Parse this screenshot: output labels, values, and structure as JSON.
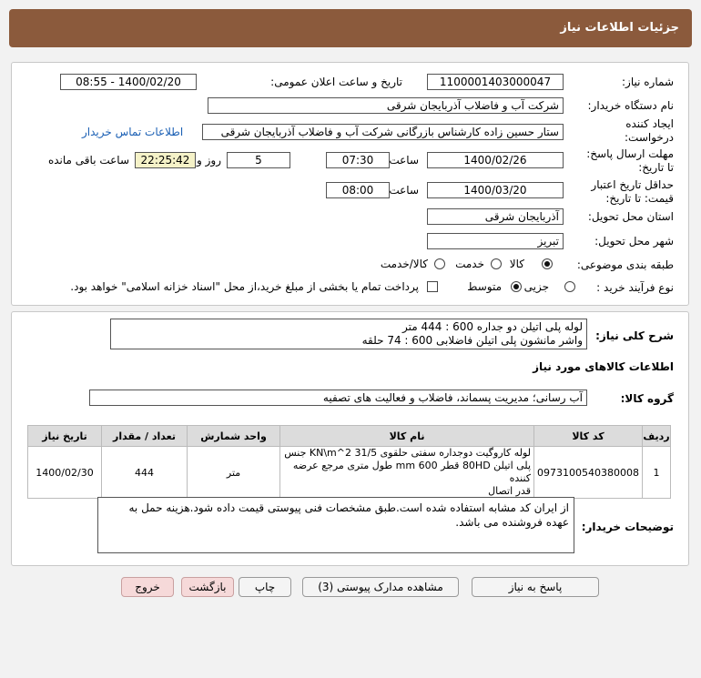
{
  "header": {
    "title": "جزئیات اطلاعات نیاز"
  },
  "form": {
    "need_number_label": "شماره نیاز:",
    "need_number": "1100001403000047",
    "announce_label": "تاریخ و ساعت اعلان عمومی:",
    "announce_value": "1400/02/20 - 08:55",
    "buyer_label": "نام دستگاه خریدار:",
    "buyer_value": "شرکت آب و فاضلاب آذربایجان شرقی",
    "creator_label": "ایجاد کننده درخواست:",
    "creator_value": "ستار حسین زاده کارشناس بازرگانی شرکت آب و فاضلاب آذربایجان شرقی",
    "contact_link": "اطلاعات تماس خریدار",
    "deadline_label": "مهلت ارسال پاسخ: تا تاریخ:",
    "deadline_date": "1400/02/26",
    "time_label": "ساعت",
    "deadline_time": "07:30",
    "days_value": "5",
    "days_label": "روز و",
    "remaining_value": "22:25:42",
    "remaining_label": "ساعت باقی مانده",
    "validity_label": "حداقل تاریخ اعتبار قیمت: تا تاریخ:",
    "validity_date": "1400/03/20",
    "validity_time": "08:00",
    "province_label": "استان محل تحویل:",
    "province_value": "آذربایجان شرقی",
    "city_label": "شهر محل تحویل:",
    "city_value": "تبریز",
    "category_label": "طبقه بندی موضوعی:",
    "category_options": [
      "کالا",
      "خدمت",
      "کالا/خدمت"
    ],
    "process_label": "نوع فرآیند خرید :",
    "process_options": [
      "جزیی",
      "متوسط"
    ],
    "process_note": "پرداخت تمام یا بخشی از مبلغ خرید،از محل \"اسناد خزانه اسلامی\" خواهد بود."
  },
  "summary": {
    "label": "شرح کلی نیاز:",
    "line1": "لوله پلی اتیلن دو جداره 600 : 444 متر",
    "line2": "واشر مانشون پلی اتیلن فاضلابی 600 : 74 حلقه"
  },
  "goods": {
    "section_title": "اطلاعات کالاهای مورد نیاز",
    "group_label": "گروه کالا:",
    "group_value": "آب رسانی؛ مدیریت پسماند، فاضلاب و فعالیت های تصفیه",
    "columns": [
      "ردیف",
      "کد کالا",
      "نام کالا",
      "واحد شمارش",
      "تعداد / مقدار",
      "تاریخ نیاز"
    ],
    "rows": [
      {
        "index": "1",
        "code": "0973100540380008",
        "name_line1": "لوله کاروگیت دوجداره سفتی حلقوی KN\\m^2 31/5 جنس",
        "name_line2": "پلی اتیلن 80HD قطر 600 mm طول متری مرجع عرضه کننده",
        "name_line3": "قدر اتصال",
        "unit": "متر",
        "qty": "444",
        "date": "1400/02/30"
      }
    ]
  },
  "buyer_notes": {
    "label": "توضیحات خریدار:",
    "line1": "از ایران کد مشابه استفاده شده است.طبق مشخصات فنی پیوستی قیمت داده شود.هزینه حمل به",
    "line2": "عهده فروشنده می باشد."
  },
  "buttons": {
    "reply": "پاسخ به نیاز",
    "attachments": "مشاهده مدارک پیوستی (3)",
    "print": "چاپ",
    "back": "بازگشت",
    "exit": "خروج"
  }
}
